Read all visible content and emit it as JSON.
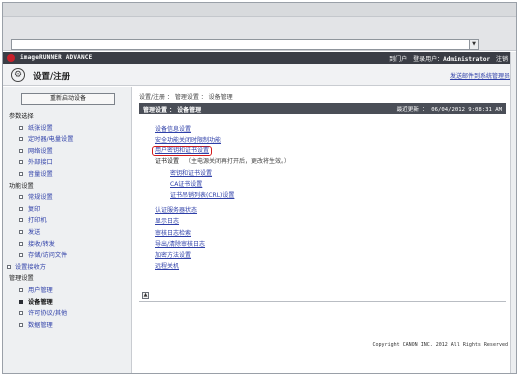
{
  "browser": {
    "url_dropdown_glyph": "▼"
  },
  "appbar": {
    "brand": "imageRUNNER ADVANCE",
    "portal_link": "到门户",
    "login_user_label": "登录用户：",
    "login_user_value": "Administrator",
    "logout_link": "注销"
  },
  "title": {
    "icon_glyph": "⚙",
    "text": "设置/注册",
    "email_link": "发送邮件到系统管理员"
  },
  "sidebar": {
    "restart_button": "重新启动设备",
    "sections": [
      {
        "label": "参数选择",
        "items": [
          "纸张设置",
          "定时器/电量设置",
          "网络设置",
          "外部接口",
          "音量设置"
        ]
      },
      {
        "label": "功能设置",
        "items": [
          "常规设置",
          "复印",
          "打印机",
          "发送",
          "接收/转发",
          "存储/访问文件"
        ]
      },
      {
        "label": "设置接收方",
        "link": true,
        "items": []
      },
      {
        "label": "管理设置",
        "items": [
          "用户管理",
          "设备管理",
          "许可协议/其他",
          "数据管理"
        ]
      }
    ]
  },
  "main": {
    "breadcrumb": "设置/注册 ： 管理设置 ： 设备管理",
    "panel_title": "管理设置 ： 设备管理",
    "last_updated": "最近更新 ： 06/04/2012 9:08:31 AM",
    "links": [
      {
        "text": "设备信息设置",
        "indent": false
      },
      {
        "text": "安全功能关闭时限制功能",
        "indent": false
      },
      {
        "text": "用户密钥和证书设置",
        "indent": false,
        "highlight": true
      },
      {
        "text": "证书设置",
        "note": "（主电源关闭再打开后，更改将生效。）",
        "indent": false,
        "plain": true
      },
      {
        "text": "密钥和证书设置",
        "indent": true
      },
      {
        "text": "CA证书设置",
        "indent": true
      },
      {
        "text": "证书吊销列表(CRL)设置",
        "indent": true
      },
      {
        "text": "认证服务器状态",
        "indent": false,
        "gap": true
      },
      {
        "text": "显示日志",
        "indent": false
      },
      {
        "text": "审核日志检索",
        "indent": false
      },
      {
        "text": "导出/清除审核日志",
        "indent": false
      },
      {
        "text": "加密方法设置",
        "indent": false
      },
      {
        "text": "远程关机",
        "indent": false
      }
    ],
    "up_glyph": "▲",
    "copyright": "Copyright CANON INC. 2012 All Rights Reserved"
  },
  "colors": {
    "link": "#2e3fa8",
    "header_dark": "#3a3d45",
    "highlight_red": "#d31a1a",
    "brand_red": "#c8202a"
  }
}
